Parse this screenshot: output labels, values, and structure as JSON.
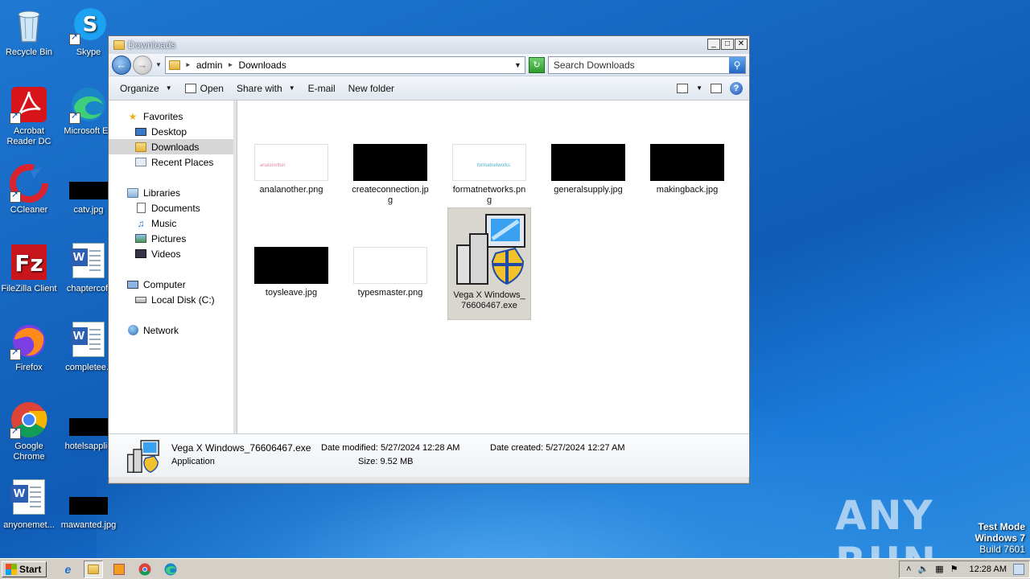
{
  "desktop": {
    "icons": [
      {
        "label": "Recycle Bin"
      },
      {
        "label": "Skype"
      },
      {
        "label": "Acrobat Reader DC"
      },
      {
        "label": "Microsoft Ed"
      },
      {
        "label": "CCleaner"
      },
      {
        "label": "catv.jpg"
      },
      {
        "label": "FileZilla Client"
      },
      {
        "label": "chaptercoff"
      },
      {
        "label": "Firefox"
      },
      {
        "label": "completee.r"
      },
      {
        "label": "Google Chrome"
      },
      {
        "label": "hotelsapplie"
      },
      {
        "label": "anyonemet..."
      },
      {
        "label": "mawanted.jpg"
      }
    ]
  },
  "window": {
    "title": "Downloads",
    "controls": {
      "minimize": "_",
      "maximize": "□",
      "close": "✕"
    },
    "address": {
      "crumbs": [
        "admin",
        "Downloads"
      ]
    },
    "search": {
      "placeholder": "Search Downloads"
    },
    "toolbar": {
      "organize": "Organize",
      "open": "Open",
      "share_with": "Share with",
      "email": "E-mail",
      "new_folder": "New folder"
    },
    "nav": {
      "favorites": "Favorites",
      "desktop": "Desktop",
      "downloads": "Downloads",
      "recent": "Recent Places",
      "libraries": "Libraries",
      "documents": "Documents",
      "music": "Music",
      "pictures": "Pictures",
      "videos": "Videos",
      "computer": "Computer",
      "local_disk": "Local Disk (C:)",
      "network": "Network"
    },
    "files": [
      {
        "name": "analanother.png",
        "thumb_text": "analanother"
      },
      {
        "name": "createconnection.jpg"
      },
      {
        "name": "formatnetworks.png",
        "thumb_text": "formatnetworks"
      },
      {
        "name": "generalsupply.jpg"
      },
      {
        "name": "makingback.jpg"
      },
      {
        "name": "toysleave.jpg"
      },
      {
        "name": "typesmaster.png"
      },
      {
        "name": "Vega X Windows_76606467.exe"
      }
    ],
    "details": {
      "name": "Vega X Windows_76606467.exe",
      "type": "Application",
      "date_modified": "Date modified: 5/27/2024 12:28 AM",
      "size": "Size: 9.52 MB",
      "date_created": "Date created: 5/27/2024 12:27 AM"
    }
  },
  "taskbar": {
    "start": "Start",
    "clock": "12:28 AM"
  },
  "watermark": {
    "line1": "Test Mode",
    "line2": "Windows 7",
    "line3": "Build 7601",
    "brand": "ANY RUN"
  }
}
